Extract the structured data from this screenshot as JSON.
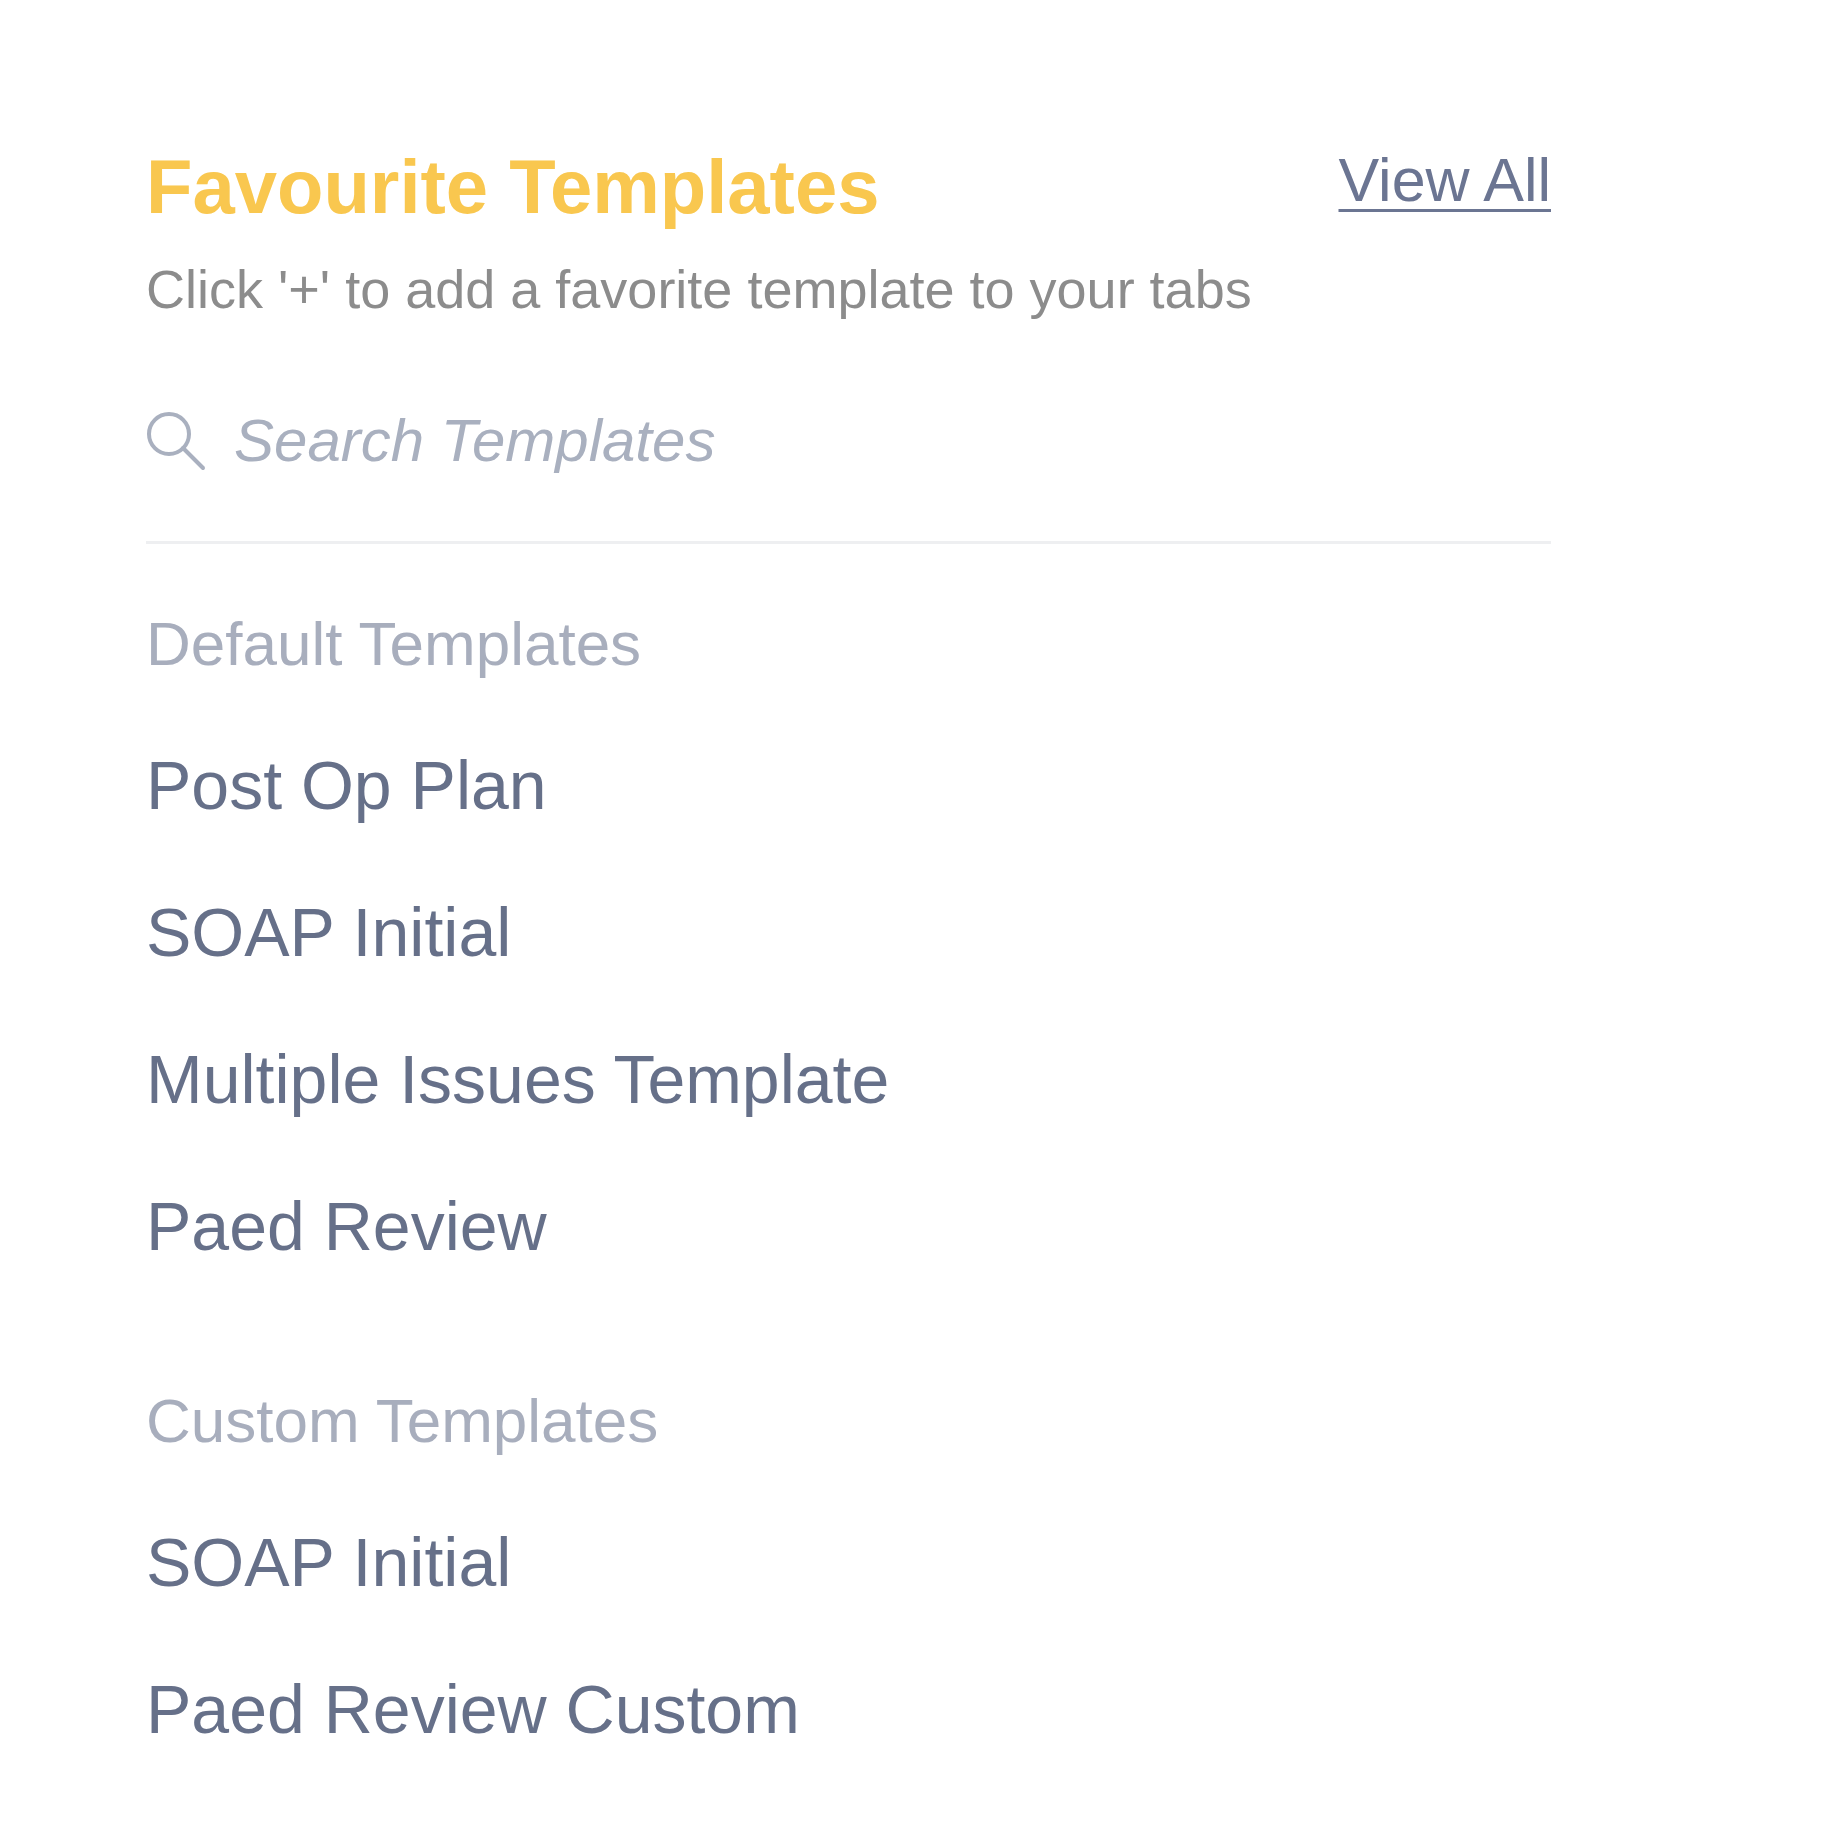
{
  "header": {
    "title": "Favourite Templates",
    "view_all": "View All",
    "subtitle": "Click '+' to add a favorite template to your tabs"
  },
  "search": {
    "placeholder": "Search Templates"
  },
  "sections": [
    {
      "title": "Default Templates",
      "items": [
        "Post Op Plan",
        "SOAP Initial",
        "Multiple Issues Template",
        "Paed Review"
      ]
    },
    {
      "title": "Custom Templates",
      "items": [
        "SOAP Initial",
        "Paed Review Custom"
      ]
    }
  ]
}
